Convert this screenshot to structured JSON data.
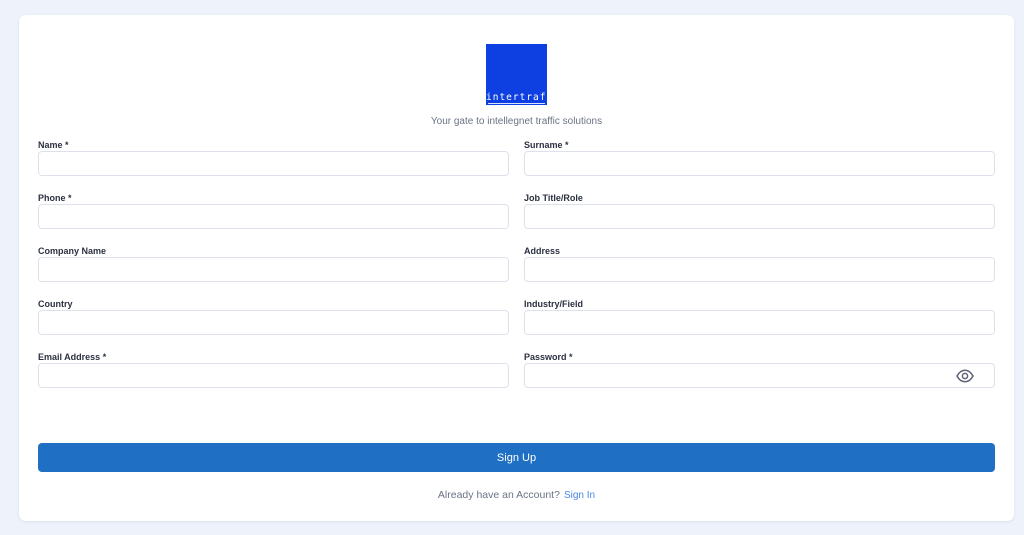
{
  "brand": {
    "logo_text": "intertraff",
    "tagline": "Your gate to intellegnet traffic solutions",
    "logo_color": "#0e3fe0"
  },
  "form": {
    "name_label": "Name *",
    "surname_label": "Surname *",
    "phone_label": "Phone *",
    "job_label": "Job Title/Role",
    "company_label": "Company Name",
    "address_label": "Address",
    "country_label": "Country",
    "industry_label": "Industry/Field",
    "email_label": "Email Address *",
    "password_label": "Password *",
    "name_value": "",
    "surname_value": "",
    "phone_value": "",
    "job_value": "",
    "company_value": "",
    "address_value": "",
    "country_value": "",
    "industry_value": "",
    "email_value": "",
    "password_value": "",
    "password_toggle_icon": "eye-icon"
  },
  "actions": {
    "signup_label": "Sign Up",
    "signup_color": "#1f6fc4",
    "have_account_text": "Already have an Account?",
    "signin_label": "Sign In"
  }
}
